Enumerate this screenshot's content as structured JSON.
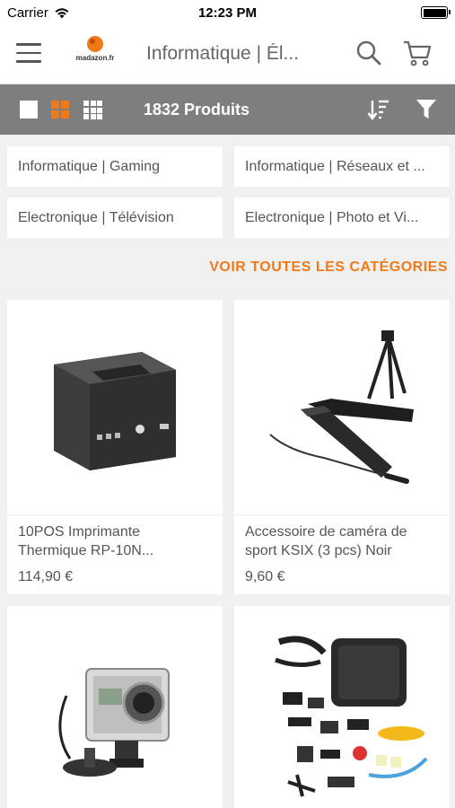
{
  "status_bar": {
    "carrier": "Carrier",
    "time": "12:23 PM"
  },
  "header": {
    "logo_text": "madazon.fr",
    "title": "Informatique | Él..."
  },
  "toolbar": {
    "product_count": "1832 Produits",
    "active_view": "grid-2"
  },
  "categories": [
    {
      "label": "Informatique | Gaming"
    },
    {
      "label": "Informatique | Réseaux et ..."
    },
    {
      "label": "Electronique | Télévision"
    },
    {
      "label": "Electronique | Photo et Vi..."
    }
  ],
  "see_all_label": "VOIR TOUTES LES CATÉGORIES",
  "products": [
    {
      "name": "10POS Imprimante Thermique RP-10N...",
      "price": "114,90 €",
      "image": "thermal-printer"
    },
    {
      "name": "Accessoire de caméra de sport KSIX (3 pcs) Noir",
      "price": "9,60 €",
      "image": "camera-selfie-stick-tripod"
    },
    {
      "name": "",
      "price": "",
      "image": "action-camera"
    },
    {
      "name": "",
      "price": "",
      "image": "action-camera-accessory-kit"
    }
  ],
  "colors": {
    "accent": "#f07a1a",
    "toolbar_bg": "#7e7e7e",
    "page_bg": "#f0f0f0"
  }
}
